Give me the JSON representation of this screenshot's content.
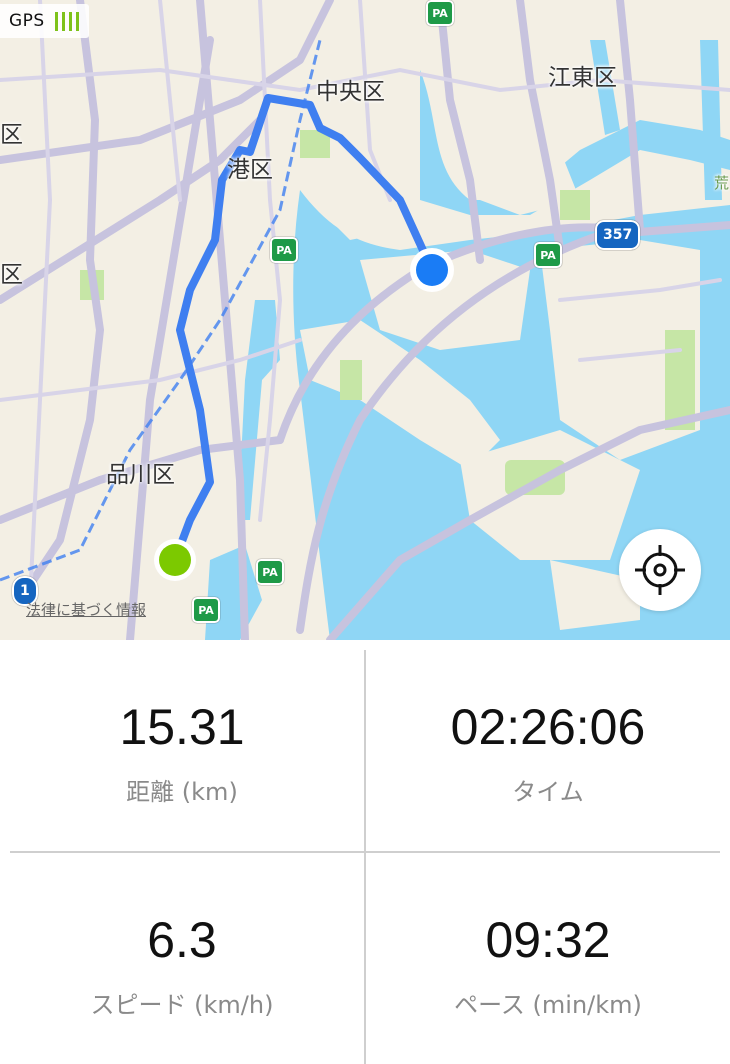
{
  "gps": {
    "label": "GPS",
    "signal_bars": 4,
    "color": "#7ec21a"
  },
  "map": {
    "wards": {
      "chuo": "中央区",
      "koto": "江東区",
      "minato": "港区",
      "shinagawa": "品川区",
      "edge_left_top": "区",
      "edge_left_mid": "区",
      "edge_right": "荒"
    },
    "parking_label": "PA",
    "route_badges": {
      "r357": "357",
      "r1": "1"
    },
    "legal_link": "法律に基づく情報",
    "route_color": "#3f7ff0",
    "water_color": "#8fd6f5",
    "start_color": "#7cc900",
    "current_color": "#1a7cf5"
  },
  "stats": {
    "distance": {
      "value": "15.31",
      "label": "距離 (km)"
    },
    "time": {
      "value": "02:26:06",
      "label": "タイム"
    },
    "speed": {
      "value": "6.3",
      "label": "スピード (km/h)"
    },
    "pace": {
      "value": "09:32",
      "label": "ペース (min/km)"
    }
  }
}
